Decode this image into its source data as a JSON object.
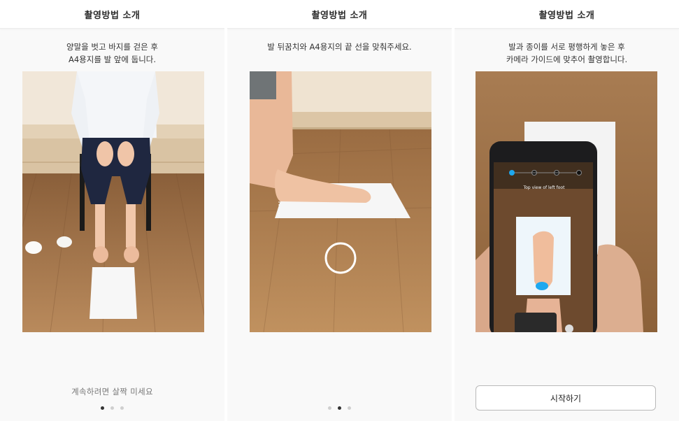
{
  "panels": [
    {
      "header": "촬영방법 소개",
      "instruction": [
        "양말을 벗고 바지를 걷은 후",
        "A4용지를 발 앞에 둡니다."
      ],
      "hint": "계속하려면 살짝 미세요",
      "page_indicator": {
        "current": 1,
        "total": 3
      }
    },
    {
      "header": "촬영방법 소개",
      "instruction": [
        "발 뒤꿈치와 A4용지의 끝 선을 맞춰주세요."
      ],
      "page_indicator": {
        "current": 2,
        "total": 3
      }
    },
    {
      "header": "촬영방법 소개",
      "instruction": [
        "발과 종이를 서로 평행하게 놓은 후",
        "카메라 가이드에 맞추어 촬영합니다."
      ],
      "phone_screen_text": "Top view of left foot",
      "start_button": "시작하기"
    }
  ],
  "colors": {
    "accent": "#1ea8ef",
    "floor": "#a97a4c",
    "wall": "#e9d9c3"
  }
}
